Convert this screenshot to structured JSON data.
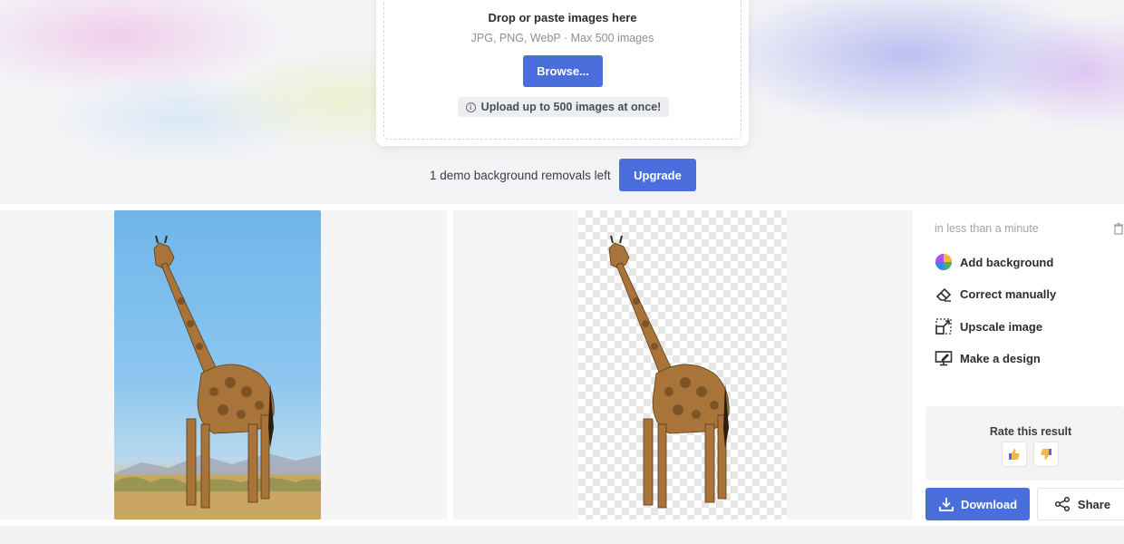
{
  "upload": {
    "title": "Drop or paste images here",
    "formats": "JPG, PNG, WebP · Max 500 images",
    "browse_label": "Browse...",
    "note": "Upload up to 500 images at once!",
    "note_icon": "info-icon"
  },
  "demo": {
    "remaining_text": "1 demo background removals left",
    "upgrade_label": "Upgrade"
  },
  "result": {
    "time_text": "in less than a minute",
    "actions": [
      {
        "label": "Add background",
        "icon": "color-wheel-icon"
      },
      {
        "label": "Correct manually",
        "icon": "eraser-icon"
      },
      {
        "label": "Upscale image",
        "icon": "upscale-icon"
      },
      {
        "label": "Make a design",
        "icon": "design-monitor-icon"
      }
    ],
    "rate_title": "Rate this result",
    "rate_up_icon": "thumbs-up-icon",
    "rate_down_icon": "thumbs-down-icon",
    "download_label": "Download",
    "share_label": "Share"
  },
  "colors": {
    "accent": "#4a6fdc"
  }
}
